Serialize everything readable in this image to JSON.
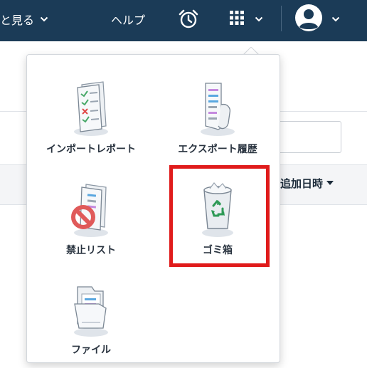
{
  "header": {
    "view_label": "と見る",
    "help_label": "ヘルプ",
    "alarm_icon": "alarm-clock-icon",
    "apps_icon": "grid-icon",
    "user_icon": "user-avatar-icon"
  },
  "background": {
    "sort_label": "追加日時"
  },
  "menu": {
    "items": [
      {
        "label": "インポートレポート",
        "icon": "import-report-icon"
      },
      {
        "label": "エクスポート履歴",
        "icon": "export-history-icon"
      },
      {
        "label": "禁止リスト",
        "icon": "block-list-icon"
      },
      {
        "label": "ゴミ箱",
        "icon": "trash-bin-icon"
      },
      {
        "label": "ファイル",
        "icon": "files-folder-icon"
      }
    ]
  },
  "colors": {
    "topbar": "#1b3b57",
    "highlight": "#e01b1b",
    "recycle_green": "#2f9a57"
  }
}
